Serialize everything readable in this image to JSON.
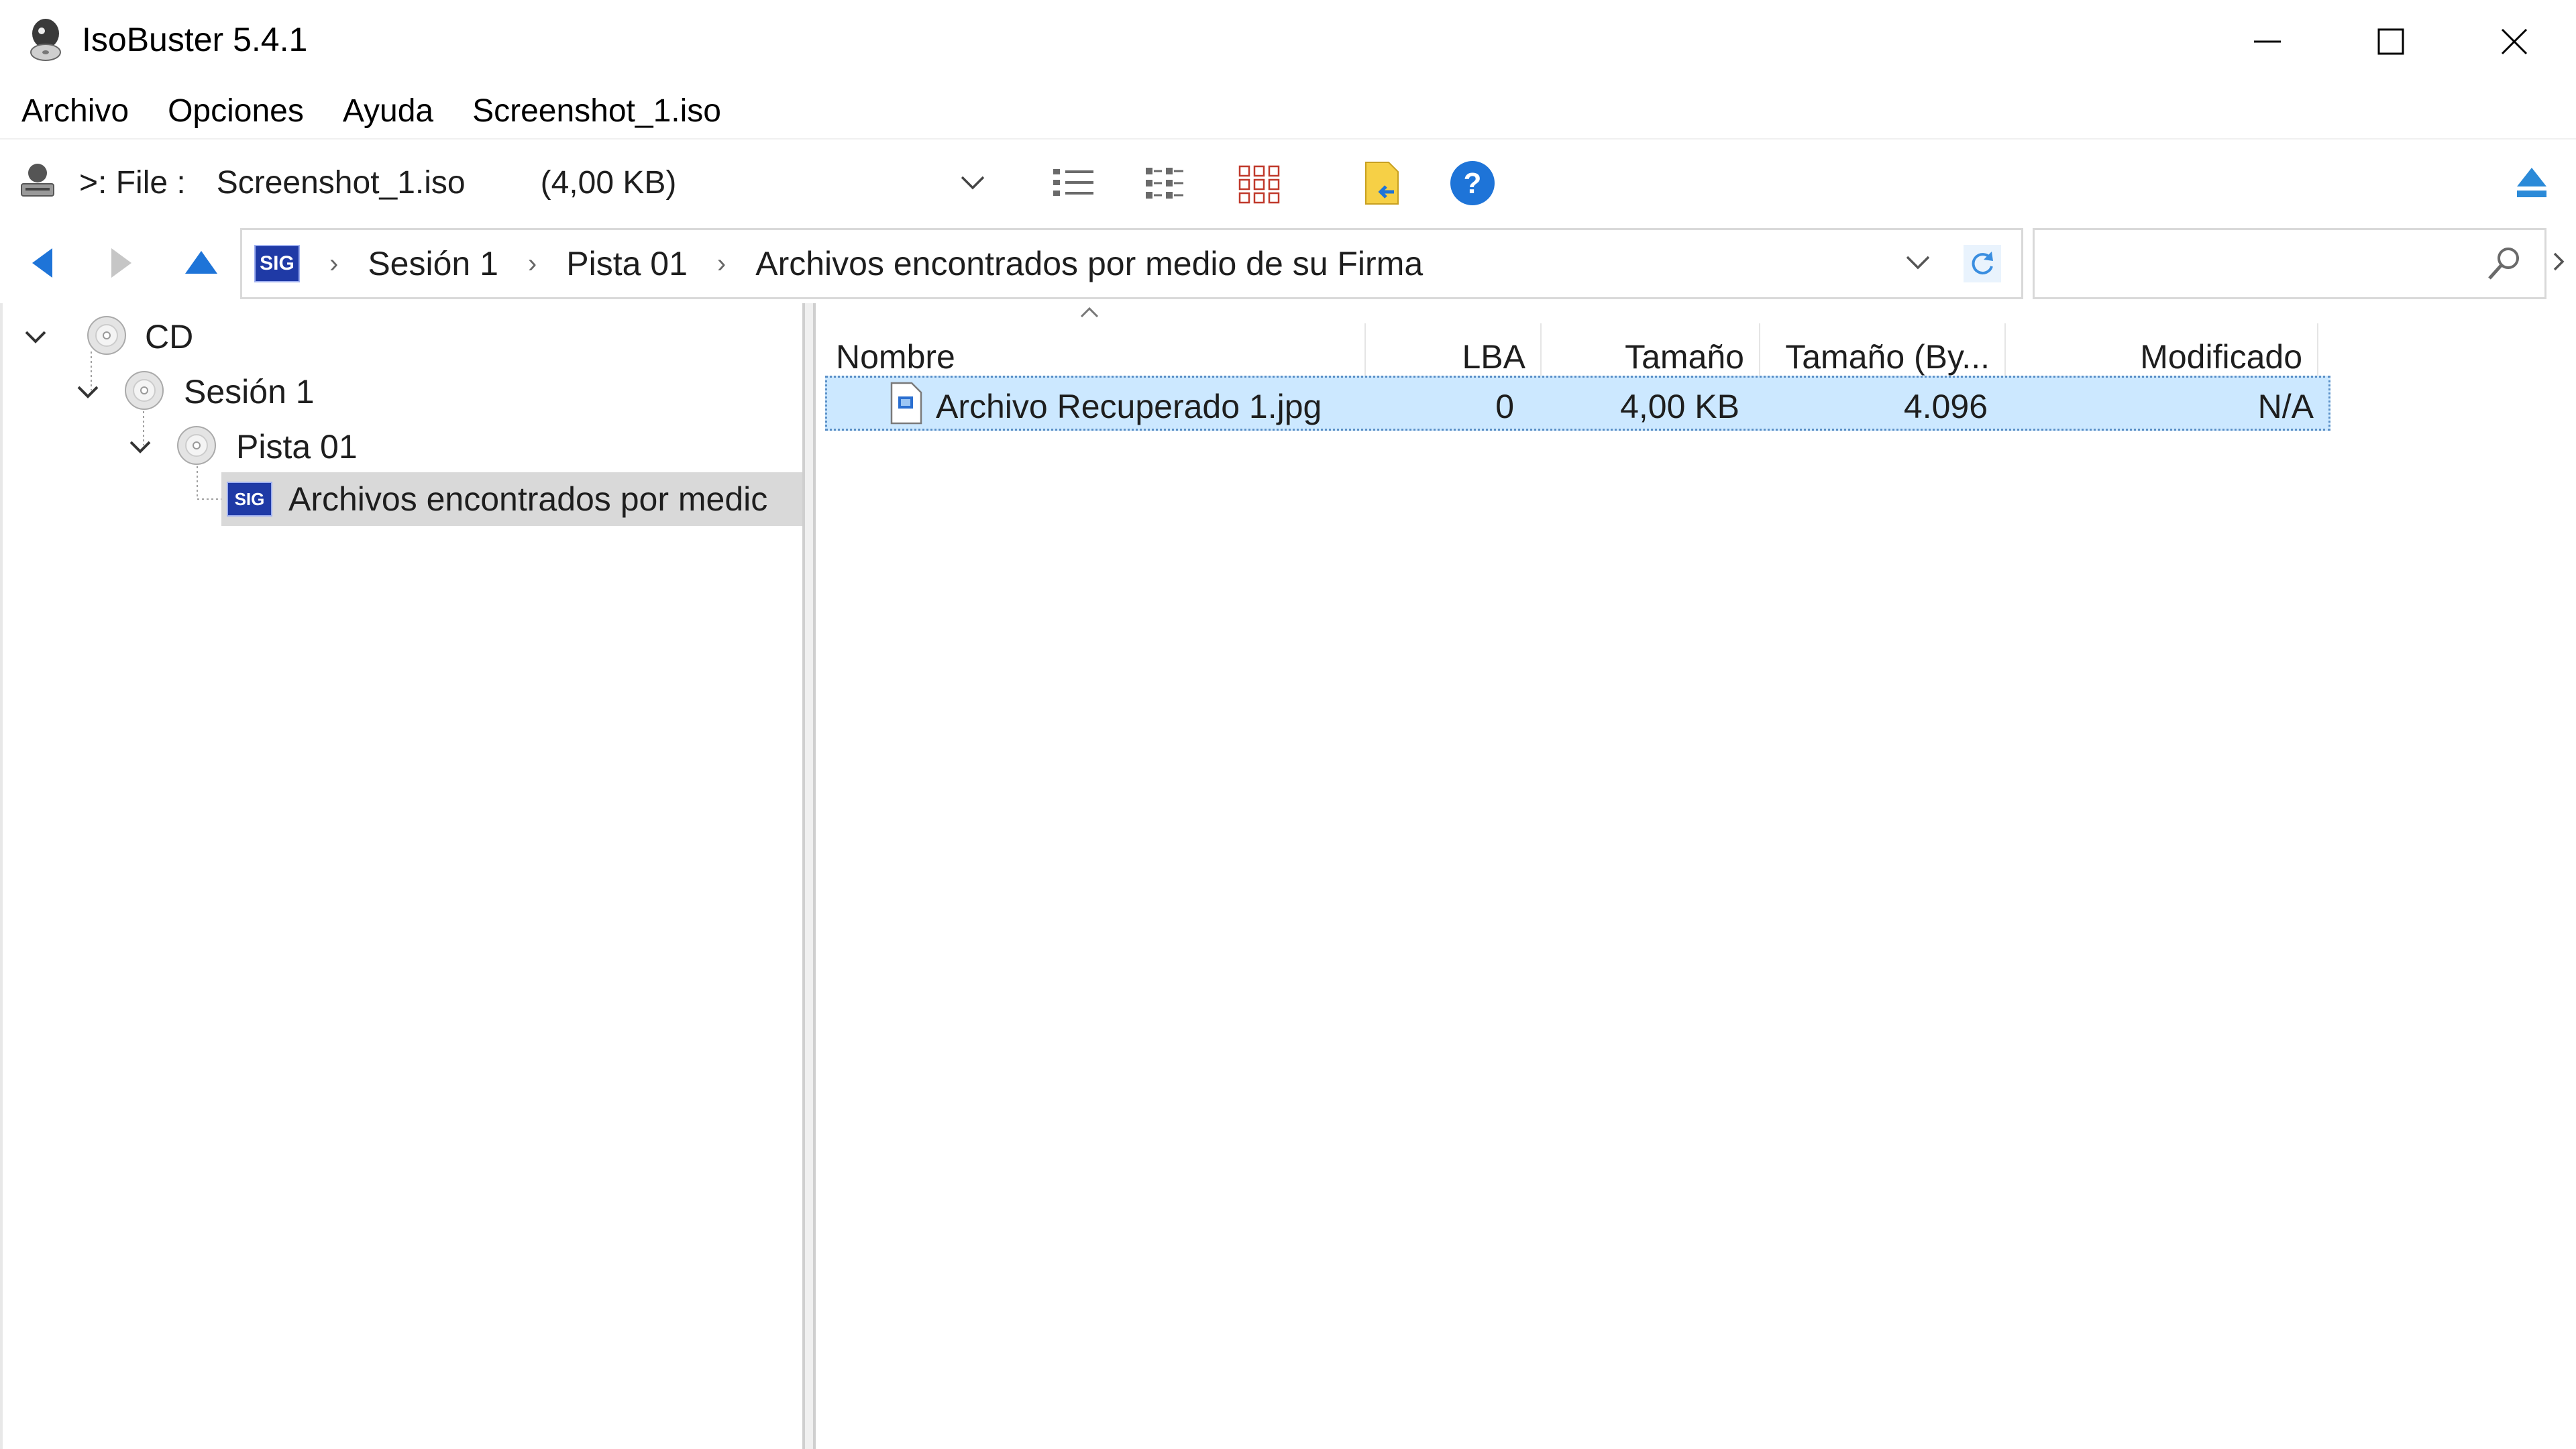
{
  "window": {
    "title": "IsoBuster 5.4.1",
    "controls": [
      "minimize-icon",
      "maximize-icon",
      "close-icon"
    ]
  },
  "menu": {
    "items": [
      {
        "label": "Archivo"
      },
      {
        "label": "Opciones"
      },
      {
        "label": "Ayuda"
      },
      {
        "label": "Screenshot_1.iso"
      }
    ]
  },
  "toolbar": {
    "device_prefix": ">: File :",
    "device_name": "Screenshot_1.iso",
    "device_size": "(4,00 KB)",
    "icons": [
      "drive-icon",
      "dropdown-chevron-icon",
      "list-view-icon",
      "details-view-icon",
      "icons-view-icon",
      "extract-icon",
      "help-icon",
      "eject-icon"
    ]
  },
  "address": {
    "badge": "SIG",
    "crumbs": [
      "Sesión 1",
      "Pista 01",
      "Archivos encontrados por medio de su Firma"
    ],
    "search_placeholder": ""
  },
  "tree": {
    "items": [
      {
        "label": "CD",
        "level": 0,
        "icon": "cd-icon",
        "expanded": true
      },
      {
        "label": "Sesión 1",
        "level": 1,
        "icon": "cd-icon",
        "expanded": true
      },
      {
        "label": "Pista 01",
        "level": 2,
        "icon": "cd-icon",
        "expanded": true
      },
      {
        "label": "Archivos encontrados por medic",
        "level": 3,
        "icon": "sig-icon",
        "badge": "SIG",
        "selected": true
      }
    ]
  },
  "table": {
    "columns": [
      "Nombre",
      "LBA",
      "Tamaño",
      "Tamaño (By...",
      "Modificado"
    ],
    "rows": [
      {
        "name": "Archivo Recuperado 1.jpg",
        "lba": "0",
        "size": "4,00 KB",
        "size_bytes": "4.096",
        "modified": "N/A",
        "selected": true
      }
    ]
  },
  "colors": {
    "accent_blue": "#1e74d8",
    "selection_bg": "#cce8ff",
    "selection_border": "#99d1ff",
    "sig_badge": "#1f3aa6"
  }
}
